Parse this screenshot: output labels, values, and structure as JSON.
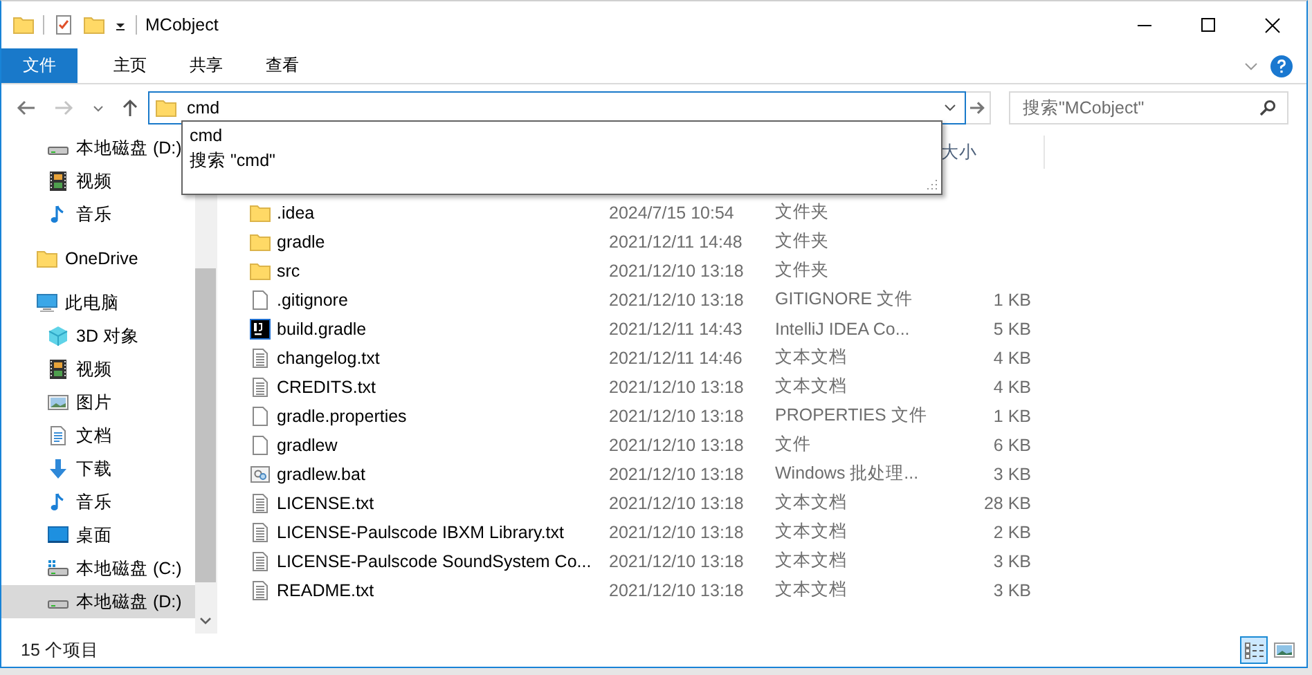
{
  "window": {
    "title": "MCobject"
  },
  "ribbon_tabs": [
    {
      "label": "文件",
      "kind": "file_menu"
    },
    {
      "label": "主页",
      "kind": "tab"
    },
    {
      "label": "共享",
      "kind": "tab"
    },
    {
      "label": "查看",
      "kind": "tab"
    }
  ],
  "address_bar": {
    "value": "cmd",
    "suggestions": [
      "cmd",
      "搜索 \"cmd\""
    ]
  },
  "search": {
    "placeholder": "搜索\"MCobject\""
  },
  "sidebar": {
    "quick_access_items": [
      {
        "label": "本地磁盘 (D:)",
        "kind": "drive",
        "selected": false
      },
      {
        "label": "视频",
        "kind": "videos",
        "selected": false
      },
      {
        "label": "音乐",
        "kind": "music",
        "selected": false
      }
    ],
    "items": [
      {
        "label": "OneDrive",
        "kind": "onedrive",
        "selected": false
      },
      {
        "label": "此电脑",
        "kind": "pc",
        "selected": false,
        "children": [
          {
            "label": "3D 对象",
            "kind": "objects3d",
            "selected": false
          },
          {
            "label": "视频",
            "kind": "videos",
            "selected": false
          },
          {
            "label": "图片",
            "kind": "pictures",
            "selected": false
          },
          {
            "label": "文档",
            "kind": "documents",
            "selected": false
          },
          {
            "label": "下载",
            "kind": "downloads",
            "selected": false
          },
          {
            "label": "音乐",
            "kind": "music",
            "selected": false
          },
          {
            "label": "桌面",
            "kind": "desktop",
            "selected": false
          },
          {
            "label": "本地磁盘 (C:)",
            "kind": "system_drive",
            "selected": false
          },
          {
            "label": "本地磁盘 (D:)",
            "kind": "drive",
            "selected": true
          }
        ]
      }
    ]
  },
  "file_list": {
    "size_header": "大小",
    "rows": [
      {
        "name": ".idea",
        "modified": "2024/7/15 10:54",
        "type": "文件夹",
        "kind": "folder"
      },
      {
        "name": "gradle",
        "modified": "2021/12/11 14:48",
        "type": "文件夹",
        "kind": "folder"
      },
      {
        "name": "src",
        "modified": "2021/12/10 13:18",
        "type": "文件夹",
        "kind": "folder"
      },
      {
        "name": ".gitignore",
        "modified": "2021/12/10 13:18",
        "type": "GITIGNORE 文件",
        "size": "1 KB",
        "kind": "file"
      },
      {
        "name": "build.gradle",
        "modified": "2021/12/11 14:43",
        "type": "IntelliJ IDEA Co...",
        "size": "5 KB",
        "kind": "ide"
      },
      {
        "name": "changelog.txt",
        "modified": "2021/12/11 14:46",
        "type": "文本文档",
        "size": "4 KB",
        "kind": "text"
      },
      {
        "name": "CREDITS.txt",
        "modified": "2021/12/10 13:18",
        "type": "文本文档",
        "size": "4 KB",
        "kind": "text"
      },
      {
        "name": "gradle.properties",
        "modified": "2021/12/10 13:18",
        "type": "PROPERTIES 文件",
        "size": "1 KB",
        "kind": "file"
      },
      {
        "name": "gradlew",
        "modified": "2021/12/10 13:18",
        "type": "文件",
        "size": "6 KB",
        "kind": "file"
      },
      {
        "name": "gradlew.bat",
        "modified": "2021/12/10 13:18",
        "type": "Windows 批处理...",
        "size": "3 KB",
        "kind": "batch"
      },
      {
        "name": "LICENSE.txt",
        "modified": "2021/12/10 13:18",
        "type": "文本文档",
        "size": "28 KB",
        "kind": "text"
      },
      {
        "name": "LICENSE-Paulscode IBXM Library.txt",
        "modified": "2021/12/10 13:18",
        "type": "文本文档",
        "size": "2 KB",
        "kind": "text"
      },
      {
        "name": "LICENSE-Paulscode SoundSystem Co...",
        "modified": "2021/12/10 13:18",
        "type": "文本文档",
        "size": "3 KB",
        "kind": "text"
      },
      {
        "name": "README.txt",
        "modified": "2021/12/10 13:18",
        "type": "文本文档",
        "size": "3 KB",
        "kind": "text"
      }
    ]
  },
  "status_bar": {
    "item_count": "15 个项目",
    "views": [
      {
        "kind": "details",
        "selected": true
      },
      {
        "kind": "large_icons",
        "selected": false
      }
    ]
  }
}
